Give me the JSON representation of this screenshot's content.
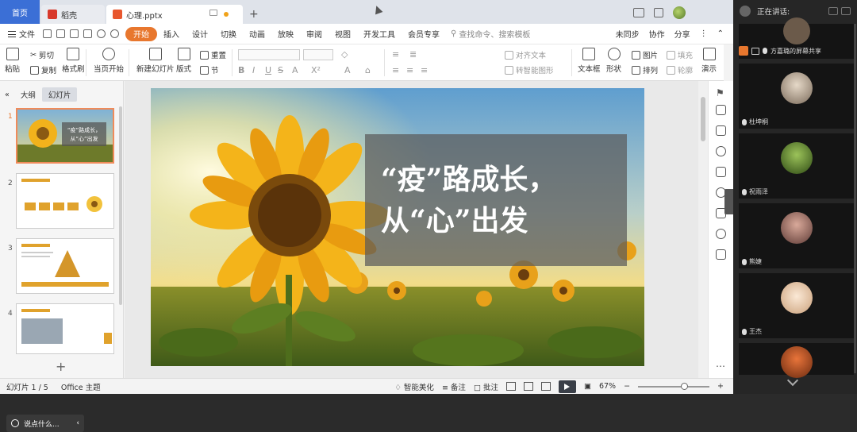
{
  "window": {
    "tabs": [
      {
        "label": "首页",
        "color": "#3b6fd6"
      },
      {
        "label": "稻壳",
        "color": "#d8392b"
      },
      {
        "label": "心理.pptx",
        "color": "#e8572e"
      }
    ],
    "new_tab": "+"
  },
  "menubar": {
    "file_label": "文件",
    "tabs": [
      "开始",
      "插入",
      "设计",
      "切换",
      "动画",
      "放映",
      "审阅",
      "视图",
      "开发工具",
      "会员专享"
    ],
    "active_tab": "开始",
    "search_placeholder": "查找命令、搜索模板",
    "right_items": [
      "未同步",
      "协作",
      "分享"
    ]
  },
  "ribbon": {
    "paste": "粘贴",
    "cut": "剪切",
    "copy": "复制",
    "format_painter": "格式刷",
    "from_current": "当页开始",
    "new_slide": "新建幻灯片",
    "layout": "版式",
    "section": "节",
    "reset": "重置",
    "align_text": "对齐文本",
    "smart_graphic": "转智能图形",
    "textbox": "文本框",
    "shape": "形状",
    "picture": "图片",
    "arrange": "排列",
    "fill": "填充",
    "outline": "轮廓",
    "show": "演示"
  },
  "left_panel": {
    "tabs": [
      "大纲",
      "幻灯片"
    ],
    "active_tab": "幻灯片",
    "slide_numbers": [
      "1",
      "2",
      "3",
      "4"
    ],
    "toast_text": "说点什么...",
    "add": "+"
  },
  "slide": {
    "title_line1": "“疫”路成长，",
    "title_line2": "从“心”出发"
  },
  "statusbar": {
    "slide_counter": "幻灯片 1 / 5",
    "theme": "Office 主题",
    "beautify": "智能美化",
    "notes": "备注",
    "comment": "批注",
    "zoom": "67%"
  },
  "meeting": {
    "speaking_label": "正在讲话:",
    "sharer": "方嘉璐的屏幕共享",
    "participants": [
      "杜坤桐",
      "祝雨泽",
      "熊婕",
      "王杰"
    ]
  },
  "colors": {
    "accent": "#e8772e",
    "home_tab": "#3b6fd6",
    "meeting_bg": "#262626"
  }
}
